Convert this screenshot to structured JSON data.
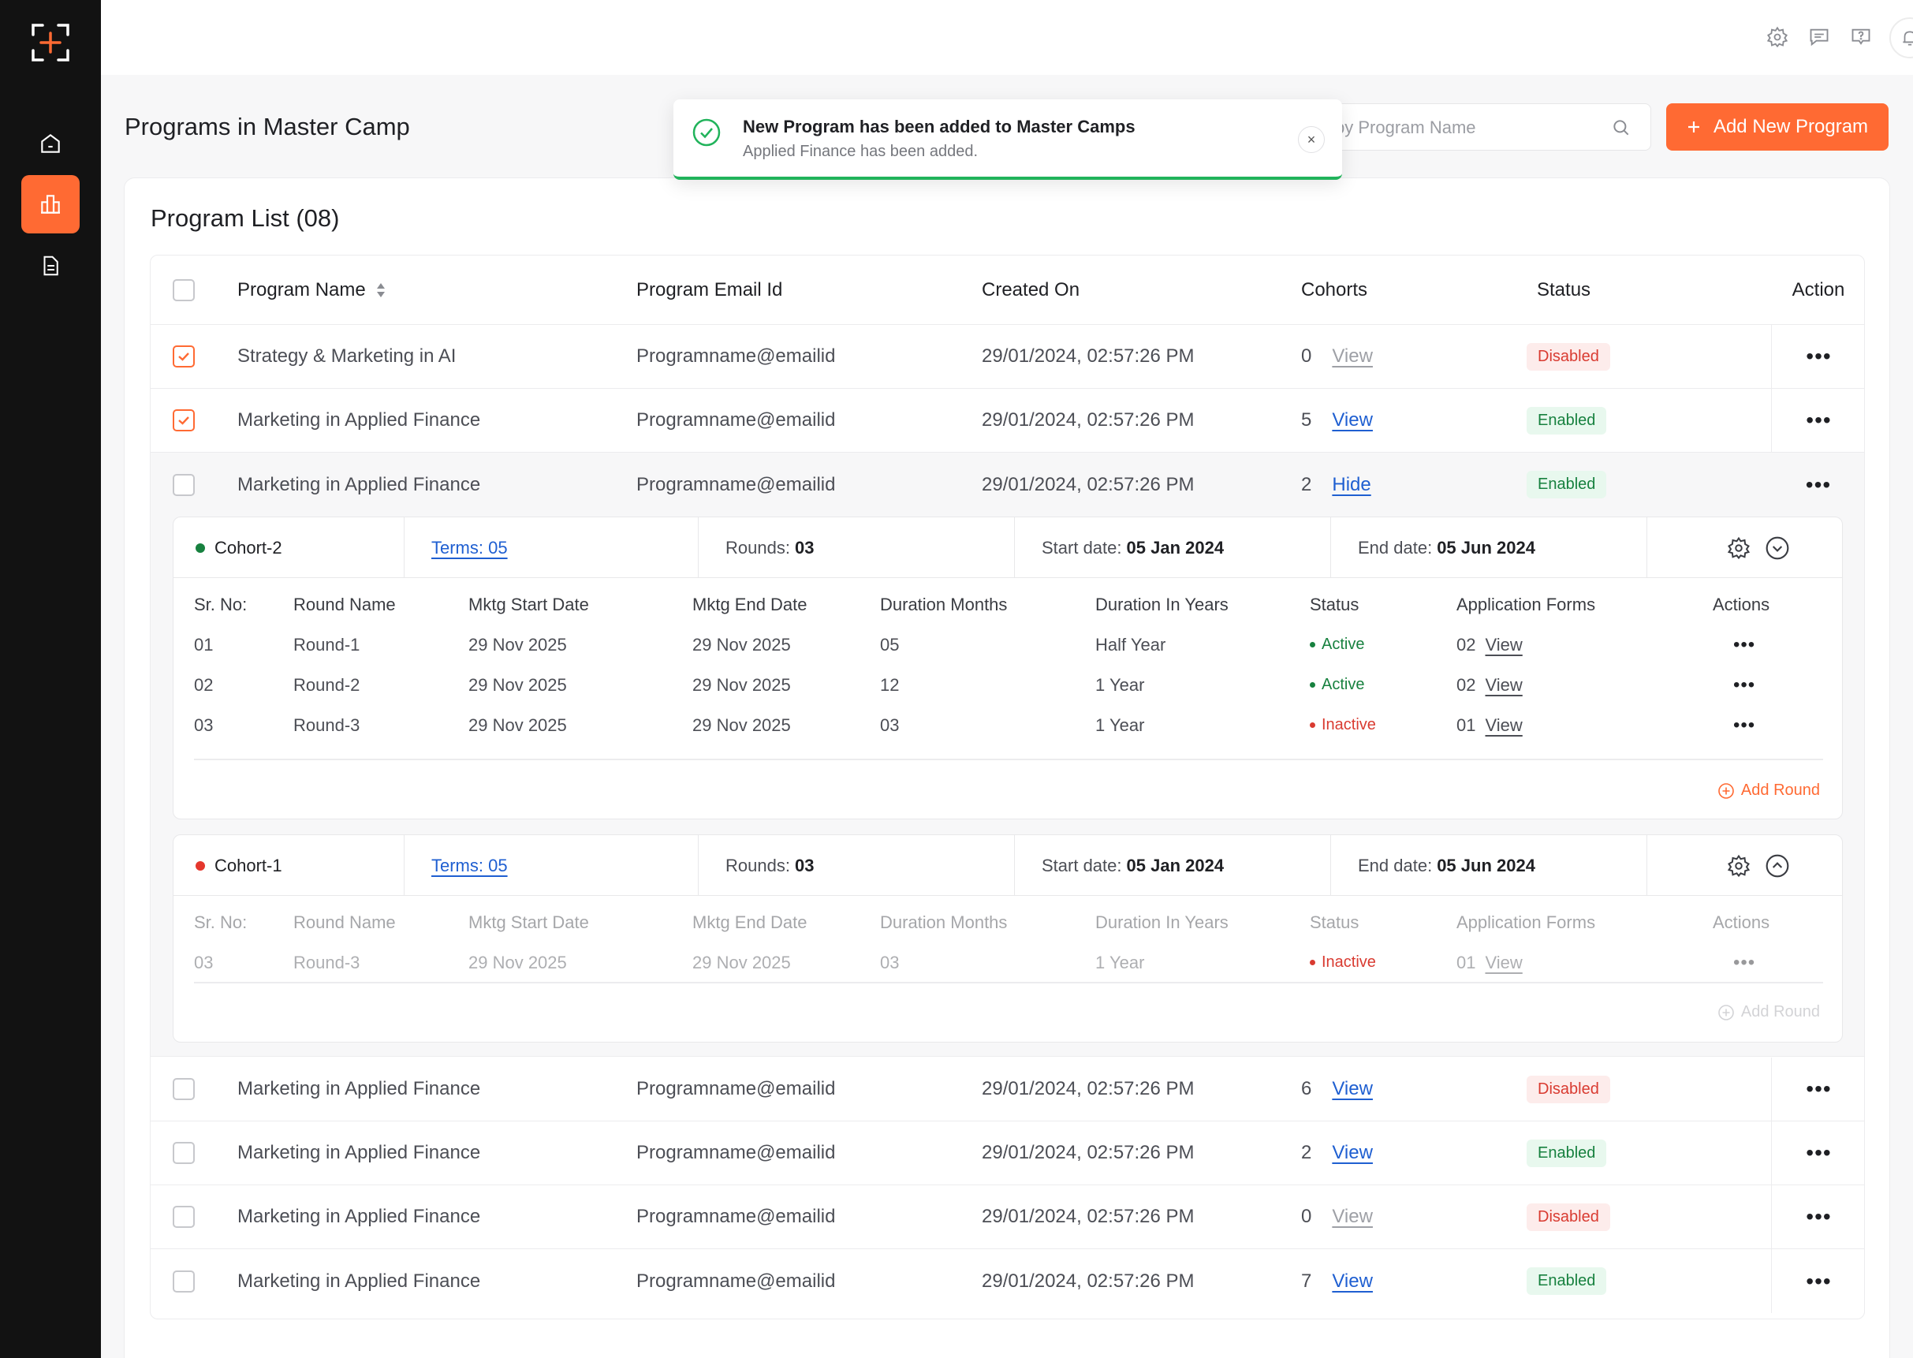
{
  "topbar": {
    "icons": [
      "settings-icon",
      "chat-icon",
      "help-icon",
      "bell-icon"
    ]
  },
  "page": {
    "title": "Programs in Master Camp"
  },
  "search": {
    "placeholder": "by Program Name"
  },
  "add_button": {
    "label": "Add New Program"
  },
  "toast": {
    "title": "New Program has been added to Master Camps",
    "subtitle": "Applied Finance has been added.",
    "close": "×"
  },
  "list": {
    "title": "Program List (08)",
    "columns": {
      "name": "Program Name",
      "email": "Program Email Id",
      "created": "Created On",
      "cohorts": "Cohorts",
      "status": "Status",
      "action": "Action"
    },
    "rows": [
      {
        "name": "Strategy & Marketing in AI",
        "email": "Programname@emailid",
        "created": "29/01/2024, 02:57:26 PM",
        "cohorts": "0",
        "link": "View",
        "status": "Disabled",
        "checked": true
      },
      {
        "name": "Marketing in Applied Finance",
        "email": "Programname@emailid",
        "created": "29/01/2024, 02:57:26 PM",
        "cohorts": "5",
        "link": "View",
        "status": "Enabled",
        "checked": true
      },
      {
        "name": "Marketing in Applied Finance",
        "email": "Programname@emailid",
        "created": "29/01/2024, 02:57:26 PM",
        "cohorts": "2",
        "link": "Hide",
        "status": "Enabled",
        "checked": false
      },
      {
        "name": "Marketing in Applied Finance",
        "email": "Programname@emailid",
        "created": "29/01/2024, 02:57:26 PM",
        "cohorts": "6",
        "link": "View",
        "status": "Disabled",
        "checked": false
      },
      {
        "name": "Marketing in Applied Finance",
        "email": "Programname@emailid",
        "created": "29/01/2024, 02:57:26 PM",
        "cohorts": "2",
        "link": "View",
        "status": "Enabled",
        "checked": false
      },
      {
        "name": "Marketing in Applied Finance",
        "email": "Programname@emailid",
        "created": "29/01/2024, 02:57:26 PM",
        "cohorts": "0",
        "link": "View",
        "status": "Disabled",
        "checked": false
      },
      {
        "name": "Marketing in Applied Finance",
        "email": "Programname@emailid",
        "created": "29/01/2024, 02:57:26 PM",
        "cohorts": "7",
        "link": "View",
        "status": "Enabled",
        "checked": false
      }
    ],
    "action_glyph": "•••"
  },
  "round_columns": {
    "sr": "Sr. No:",
    "name": "Round Name",
    "start": "Mktg Start Date",
    "end": "Mktg End Date",
    "months": "Duration Months",
    "years": "Duration In Years",
    "status": "Status",
    "forms": "Application Forms",
    "actions": "Actions"
  },
  "cohorts": [
    {
      "name": "Cohort-2",
      "dot_color": "#17813f",
      "terms": "Terms: 05",
      "rounds_label": "Rounds:",
      "rounds_value": "03",
      "start_label": "Start date:",
      "start_value": "05 Jan 2024",
      "end_label": "End date:",
      "end_value": "05 Jun 2024",
      "add_round": "Add Round",
      "rounds": [
        {
          "sr": "01",
          "name": "Round-1",
          "start": "29 Nov 2025",
          "end": "29 Nov 2025",
          "months": "05",
          "years": "Half Year",
          "status": "Active",
          "forms": "02",
          "view": "View"
        },
        {
          "sr": "02",
          "name": "Round-2",
          "start": "29 Nov 2025",
          "end": "29 Nov 2025",
          "months": "12",
          "years": "1 Year",
          "status": "Active",
          "forms": "02",
          "view": "View"
        },
        {
          "sr": "03",
          "name": "Round-3",
          "start": "29 Nov 2025",
          "end": "29 Nov 2025",
          "months": "03",
          "years": "1 Year",
          "status": "Inactive",
          "forms": "01",
          "view": "View"
        }
      ]
    },
    {
      "name": "Cohort-1",
      "dot_color": "#e5372d",
      "terms": "Terms: 05",
      "rounds_label": "Rounds:",
      "rounds_value": "03",
      "start_label": "Start date:",
      "start_value": "05 Jan 2024",
      "end_label": "End date:",
      "end_value": "05 Jun 2024",
      "add_round": "Add Round",
      "rounds": [
        {
          "sr": "03",
          "name": "Round-3",
          "start": "29 Nov 2025",
          "end": "29 Nov 2025",
          "months": "03",
          "years": "1 Year",
          "status": "Inactive",
          "forms": "01",
          "view": "View"
        }
      ]
    }
  ],
  "colors": {
    "accent": "#ff6a33",
    "enabled": "#17813f",
    "disabled": "#d93b31",
    "link": "#1f5fd1"
  }
}
